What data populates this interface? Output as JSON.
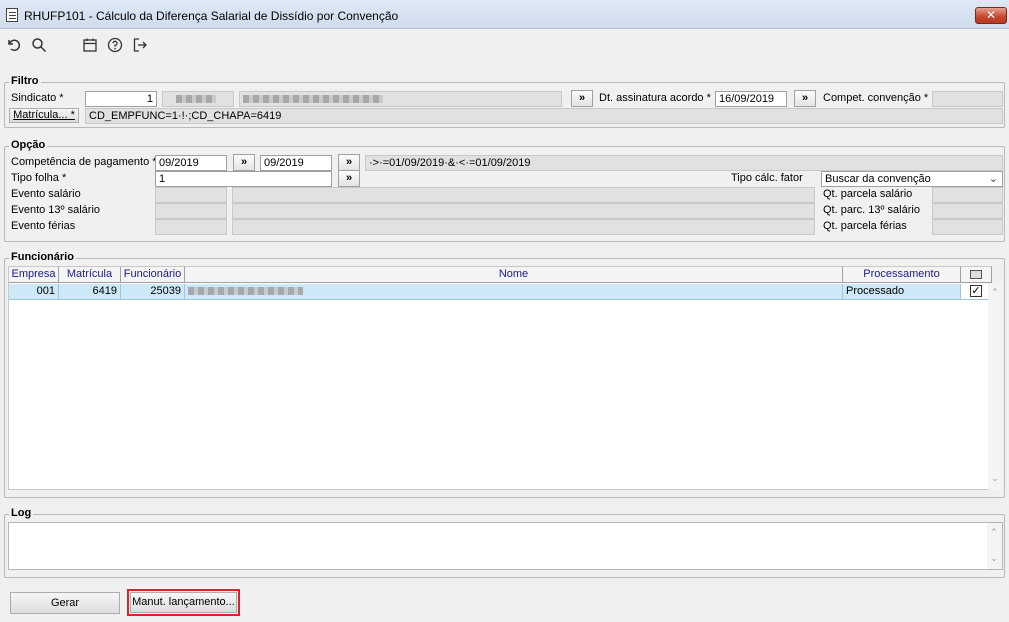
{
  "window": {
    "title": "RHUFP101 - Cálculo da Diferença Salarial de Dissídio por Convenção",
    "close_glyph": "✕"
  },
  "toolbar": {
    "icons": [
      "undo-icon",
      "search-icon",
      "calendar-icon",
      "help-icon",
      "exit-icon"
    ]
  },
  "filtro": {
    "title": "Filtro",
    "sindicato_label": "Sindicato *",
    "sindicato_value": "1",
    "dt_assinatura_label": "Dt. assinatura acordo *",
    "dt_assinatura_value": "16/09/2019",
    "compet_convencao_label": "Compet. convenção *",
    "compet_convencao_value": "",
    "matricula_button": "Matrícula... *",
    "matricula_filter_value": "CD_EMPFUNC=1·!·;CD_CHAPA=6419",
    "lookup_button": "»"
  },
  "opcao": {
    "title": "Opção",
    "competencia_label": "Competência de pagamento *",
    "competencia_from": "09/2019",
    "competencia_to": "09/2019",
    "competencia_expr": "·>·=01/09/2019·&·<·=01/09/2019",
    "tipo_folha_label": "Tipo folha *",
    "tipo_folha_value": "1",
    "tipo_calc_fator_label": "Tipo cálc. fator",
    "tipo_calc_fator_value": "Buscar da convenção",
    "evento_salario_label": "Evento salário",
    "evento_13_label": "Evento 13º salário",
    "evento_ferias_label": "Evento férias",
    "qt_parcela_salario_label": "Qt. parcela salário",
    "qt_parc_13_label": "Qt. parc. 13º salário",
    "qt_parcela_ferias_label": "Qt. parcela férias"
  },
  "funcionario": {
    "title": "Funcionário",
    "columns": [
      "Empresa",
      "Matrícula",
      "Funcionário",
      "Nome",
      "Processamento"
    ],
    "rows": [
      {
        "empresa": "001",
        "matricula": "6419",
        "funcionario": "25039",
        "nome": "",
        "processamento": "Processado",
        "checked": true
      }
    ]
  },
  "log": {
    "title": "Log",
    "content": ""
  },
  "footer": {
    "gerar_button": "Gerar",
    "manut_button": "Manut. lançamento...",
    "highlight_color": "#d9242b"
  }
}
